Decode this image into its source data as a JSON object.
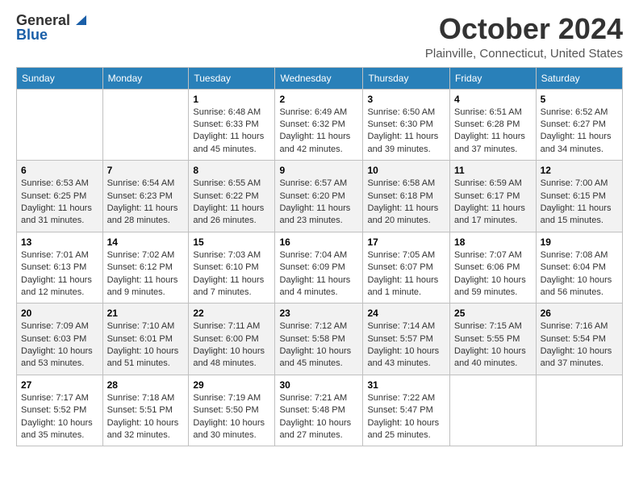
{
  "logo": {
    "general": "General",
    "blue": "Blue"
  },
  "title": "October 2024",
  "location": "Plainville, Connecticut, United States",
  "weekdays": [
    "Sunday",
    "Monday",
    "Tuesday",
    "Wednesday",
    "Thursday",
    "Friday",
    "Saturday"
  ],
  "weeks": [
    [
      {
        "day": "",
        "info": ""
      },
      {
        "day": "",
        "info": ""
      },
      {
        "day": "1",
        "info": "Sunrise: 6:48 AM\nSunset: 6:33 PM\nDaylight: 11 hours and 45 minutes."
      },
      {
        "day": "2",
        "info": "Sunrise: 6:49 AM\nSunset: 6:32 PM\nDaylight: 11 hours and 42 minutes."
      },
      {
        "day": "3",
        "info": "Sunrise: 6:50 AM\nSunset: 6:30 PM\nDaylight: 11 hours and 39 minutes."
      },
      {
        "day": "4",
        "info": "Sunrise: 6:51 AM\nSunset: 6:28 PM\nDaylight: 11 hours and 37 minutes."
      },
      {
        "day": "5",
        "info": "Sunrise: 6:52 AM\nSunset: 6:27 PM\nDaylight: 11 hours and 34 minutes."
      }
    ],
    [
      {
        "day": "6",
        "info": "Sunrise: 6:53 AM\nSunset: 6:25 PM\nDaylight: 11 hours and 31 minutes."
      },
      {
        "day": "7",
        "info": "Sunrise: 6:54 AM\nSunset: 6:23 PM\nDaylight: 11 hours and 28 minutes."
      },
      {
        "day": "8",
        "info": "Sunrise: 6:55 AM\nSunset: 6:22 PM\nDaylight: 11 hours and 26 minutes."
      },
      {
        "day": "9",
        "info": "Sunrise: 6:57 AM\nSunset: 6:20 PM\nDaylight: 11 hours and 23 minutes."
      },
      {
        "day": "10",
        "info": "Sunrise: 6:58 AM\nSunset: 6:18 PM\nDaylight: 11 hours and 20 minutes."
      },
      {
        "day": "11",
        "info": "Sunrise: 6:59 AM\nSunset: 6:17 PM\nDaylight: 11 hours and 17 minutes."
      },
      {
        "day": "12",
        "info": "Sunrise: 7:00 AM\nSunset: 6:15 PM\nDaylight: 11 hours and 15 minutes."
      }
    ],
    [
      {
        "day": "13",
        "info": "Sunrise: 7:01 AM\nSunset: 6:13 PM\nDaylight: 11 hours and 12 minutes."
      },
      {
        "day": "14",
        "info": "Sunrise: 7:02 AM\nSunset: 6:12 PM\nDaylight: 11 hours and 9 minutes."
      },
      {
        "day": "15",
        "info": "Sunrise: 7:03 AM\nSunset: 6:10 PM\nDaylight: 11 hours and 7 minutes."
      },
      {
        "day": "16",
        "info": "Sunrise: 7:04 AM\nSunset: 6:09 PM\nDaylight: 11 hours and 4 minutes."
      },
      {
        "day": "17",
        "info": "Sunrise: 7:05 AM\nSunset: 6:07 PM\nDaylight: 11 hours and 1 minute."
      },
      {
        "day": "18",
        "info": "Sunrise: 7:07 AM\nSunset: 6:06 PM\nDaylight: 10 hours and 59 minutes."
      },
      {
        "day": "19",
        "info": "Sunrise: 7:08 AM\nSunset: 6:04 PM\nDaylight: 10 hours and 56 minutes."
      }
    ],
    [
      {
        "day": "20",
        "info": "Sunrise: 7:09 AM\nSunset: 6:03 PM\nDaylight: 10 hours and 53 minutes."
      },
      {
        "day": "21",
        "info": "Sunrise: 7:10 AM\nSunset: 6:01 PM\nDaylight: 10 hours and 51 minutes."
      },
      {
        "day": "22",
        "info": "Sunrise: 7:11 AM\nSunset: 6:00 PM\nDaylight: 10 hours and 48 minutes."
      },
      {
        "day": "23",
        "info": "Sunrise: 7:12 AM\nSunset: 5:58 PM\nDaylight: 10 hours and 45 minutes."
      },
      {
        "day": "24",
        "info": "Sunrise: 7:14 AM\nSunset: 5:57 PM\nDaylight: 10 hours and 43 minutes."
      },
      {
        "day": "25",
        "info": "Sunrise: 7:15 AM\nSunset: 5:55 PM\nDaylight: 10 hours and 40 minutes."
      },
      {
        "day": "26",
        "info": "Sunrise: 7:16 AM\nSunset: 5:54 PM\nDaylight: 10 hours and 37 minutes."
      }
    ],
    [
      {
        "day": "27",
        "info": "Sunrise: 7:17 AM\nSunset: 5:52 PM\nDaylight: 10 hours and 35 minutes."
      },
      {
        "day": "28",
        "info": "Sunrise: 7:18 AM\nSunset: 5:51 PM\nDaylight: 10 hours and 32 minutes."
      },
      {
        "day": "29",
        "info": "Sunrise: 7:19 AM\nSunset: 5:50 PM\nDaylight: 10 hours and 30 minutes."
      },
      {
        "day": "30",
        "info": "Sunrise: 7:21 AM\nSunset: 5:48 PM\nDaylight: 10 hours and 27 minutes."
      },
      {
        "day": "31",
        "info": "Sunrise: 7:22 AM\nSunset: 5:47 PM\nDaylight: 10 hours and 25 minutes."
      },
      {
        "day": "",
        "info": ""
      },
      {
        "day": "",
        "info": ""
      }
    ]
  ]
}
